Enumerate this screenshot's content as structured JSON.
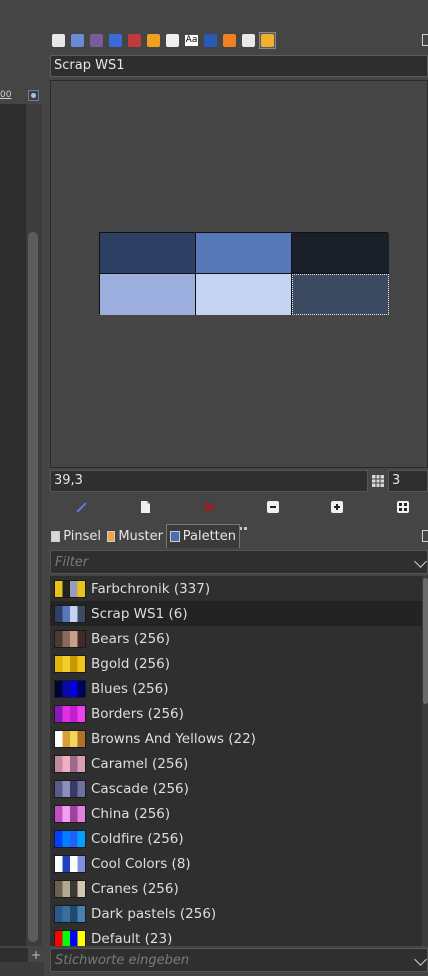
{
  "left_panel": {
    "ruler_label": "00"
  },
  "dock_tabs": [
    {
      "icon": "layers-icon"
    },
    {
      "icon": "paths-icon"
    },
    {
      "icon": "channels-icon"
    },
    {
      "icon": "fg-bg-colors-icon"
    },
    {
      "icon": "colormap-icon"
    },
    {
      "icon": "undo-history-icon"
    },
    {
      "icon": "brush-editor-icon"
    },
    {
      "icon": "fonts-icon",
      "text": "Aa"
    },
    {
      "icon": "pattern-icon"
    },
    {
      "icon": "warning-icon"
    },
    {
      "icon": "image-icon"
    },
    {
      "icon": "palette-editor-icon",
      "active": true
    }
  ],
  "palette_editor": {
    "title": "Scrap WS1",
    "swatches": [
      "#2f4065",
      "#5778b8",
      "#1b1f2a",
      "#9caede",
      "#c4d3f1",
      "#3b4a60"
    ],
    "selected_swatch": 5,
    "selected_name": "39,3",
    "columns": "3",
    "actions": [
      {
        "name": "edit-color-button",
        "icon": "pencil-icon"
      },
      {
        "name": "new-color-button",
        "icon": "new-document-icon"
      },
      {
        "name": "delete-color-button",
        "icon": "delete-x-icon"
      },
      {
        "name": "zoom-out-button",
        "icon": "zoom-out-icon"
      },
      {
        "name": "zoom-in-button",
        "icon": "zoom-in-icon"
      },
      {
        "name": "zoom-all-button",
        "icon": "zoom-all-icon"
      }
    ]
  },
  "lower_tabs": [
    {
      "label": "Pinsel",
      "icon": "brush-tab-icon",
      "color": "#d8d8d8"
    },
    {
      "label": "Muster",
      "icon": "pattern-tab-icon",
      "color": "#f3a444"
    },
    {
      "label": "Paletten",
      "icon": "palette-tab-icon",
      "color": "#4a6fb0",
      "active": true
    }
  ],
  "filter": {
    "placeholder": "Filter"
  },
  "palettes": [
    {
      "label": "Farbchronik (337)",
      "colors": [
        "#e7c41a",
        "#222",
        "#9c9cb8",
        "#e7c41a"
      ]
    },
    {
      "label": "Scrap WS1 (6)",
      "colors": [
        "#2f4065",
        "#5778b8",
        "#c4d3f1",
        "#3b4a60"
      ],
      "selected": true
    },
    {
      "label": "Bears (256)",
      "colors": [
        "#4a3a33",
        "#8a6a5e",
        "#c8a08a",
        "#3e2c26"
      ]
    },
    {
      "label": "Bgold (256)",
      "colors": [
        "#e3b40e",
        "#f2cf2b",
        "#c79a05",
        "#f0c21d"
      ]
    },
    {
      "label": "Blues (256)",
      "colors": [
        "#020238",
        "#0a0aa8",
        "#0000e0",
        "#000060"
      ]
    },
    {
      "label": "Borders (256)",
      "colors": [
        "#8a1ab8",
        "#e030e0",
        "#c020d0",
        "#f040f0"
      ]
    },
    {
      "label": "Browns And Yellows (22)",
      "colors": [
        "#ffffff",
        "#d9a03a",
        "#f3d55a",
        "#b3702a"
      ]
    },
    {
      "label": "Caramel (256)",
      "colors": [
        "#c08aa0",
        "#f0b0c0",
        "#9a6a90",
        "#d8a0b0"
      ]
    },
    {
      "label": "Cascade (256)",
      "colors": [
        "#5a5a8a",
        "#8a90b8",
        "#3a3a6a",
        "#7070a0"
      ]
    },
    {
      "label": "China (256)",
      "colors": [
        "#c050c0",
        "#f0a0f0",
        "#a040a0",
        "#e080e0"
      ]
    },
    {
      "label": "Coldfire (256)",
      "colors": [
        "#0040ff",
        "#0080ff",
        "#2060ff",
        "#00a0ff"
      ]
    },
    {
      "label": "Cool Colors (8)",
      "colors": [
        "#ffffff",
        "#2040c0",
        "#ffffff",
        "#8090e0"
      ]
    },
    {
      "label": "Cranes (256)",
      "colors": [
        "#6a6050",
        "#b0a890",
        "#3a3a30",
        "#d0c8b0"
      ]
    },
    {
      "label": "Dark pastels (256)",
      "colors": [
        "#2a5a8a",
        "#3a70a0",
        "#204a70",
        "#4a80b0"
      ]
    },
    {
      "label": "Default (23)",
      "colors": [
        "#ff0000",
        "#00ff00",
        "#0000ff",
        "#ffff00"
      ]
    }
  ],
  "tag_entry": {
    "placeholder": "Stichworte eingeben"
  }
}
